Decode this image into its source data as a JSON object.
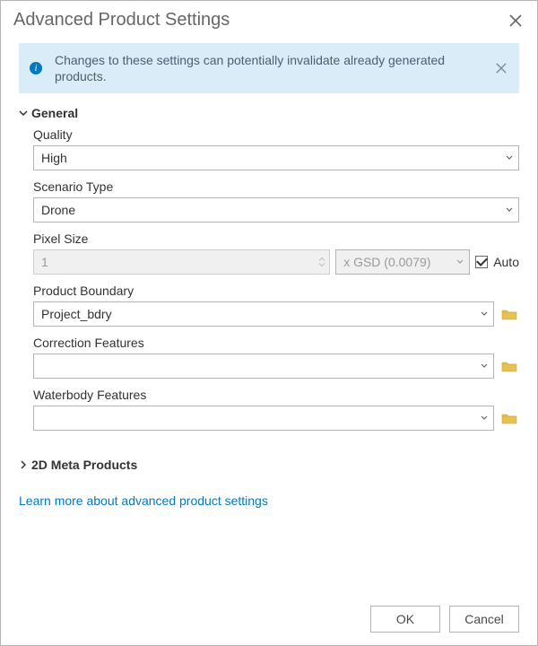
{
  "title": "Advanced Product Settings",
  "banner": {
    "text": "Changes to these settings can potentially invalidate already generated products."
  },
  "sections": {
    "general": {
      "header": "General",
      "quality": {
        "label": "Quality",
        "value": "High"
      },
      "scenario": {
        "label": "Scenario Type",
        "value": "Drone"
      },
      "pixel": {
        "label": "Pixel Size",
        "value": "1",
        "gsd": "x GSD (0.0079)",
        "auto": "Auto"
      },
      "boundary": {
        "label": "Product Boundary",
        "value": "Project_bdry"
      },
      "correction": {
        "label": "Correction Features",
        "value": ""
      },
      "water": {
        "label": "Waterbody Features",
        "value": ""
      }
    },
    "meta2d": {
      "header": "2D Meta Products"
    }
  },
  "link": "Learn more about advanced product settings",
  "footer": {
    "ok": "OK",
    "cancel": "Cancel"
  }
}
